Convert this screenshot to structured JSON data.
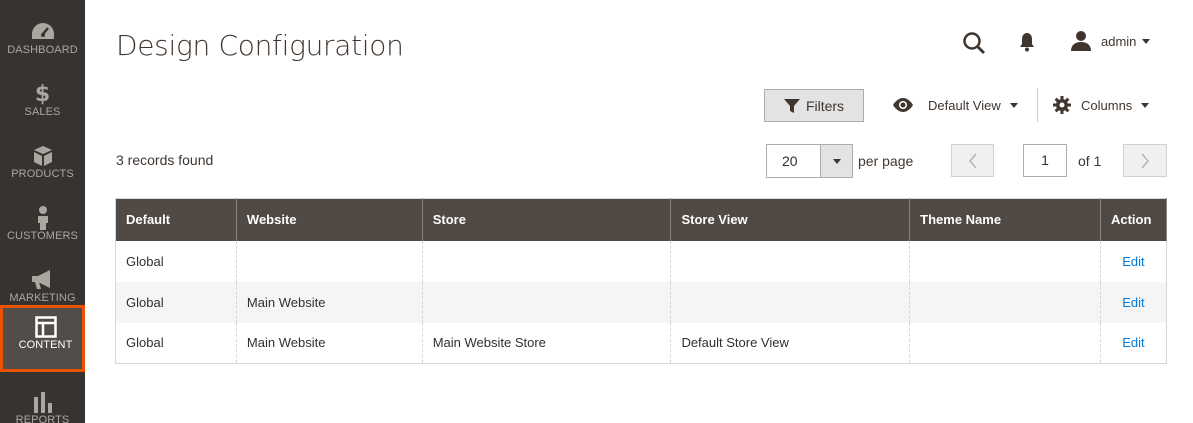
{
  "sidebar": {
    "items": [
      {
        "label": "DASHBOARD",
        "icon": "dashboard-icon"
      },
      {
        "label": "SALES",
        "icon": "dollar-icon"
      },
      {
        "label": "PRODUCTS",
        "icon": "box-icon"
      },
      {
        "label": "CUSTOMERS",
        "icon": "person-icon"
      },
      {
        "label": "MARKETING",
        "icon": "megaphone-icon"
      },
      {
        "label": "CONTENT",
        "icon": "layout-icon",
        "active": true
      },
      {
        "label": "REPORTS",
        "icon": "bar-chart-icon"
      }
    ]
  },
  "header": {
    "title": "Design Configuration",
    "user": "admin"
  },
  "toolbar": {
    "filters_label": "Filters",
    "view_label": "Default View",
    "columns_label": "Columns"
  },
  "records": {
    "found_text": "3 records found",
    "per_page_value": "20",
    "per_page_label": "per page",
    "current_page": "1",
    "total_pages_text": "of 1"
  },
  "grid": {
    "columns": [
      "Default",
      "Website",
      "Store",
      "Store View",
      "Theme Name",
      "Action"
    ],
    "rows": [
      [
        "Global",
        "",
        "",
        "",
        "",
        "Edit"
      ],
      [
        "Global",
        "Main Website",
        "",
        "",
        "",
        "Edit"
      ],
      [
        "Global",
        "Main Website",
        "Main Website Store",
        "Default Store View",
        "",
        "Edit"
      ]
    ]
  },
  "colors": {
    "sidebar_bg": "#373330",
    "active_border": "#eb5202",
    "table_header_bg": "#514943",
    "link": "#007bdb"
  }
}
